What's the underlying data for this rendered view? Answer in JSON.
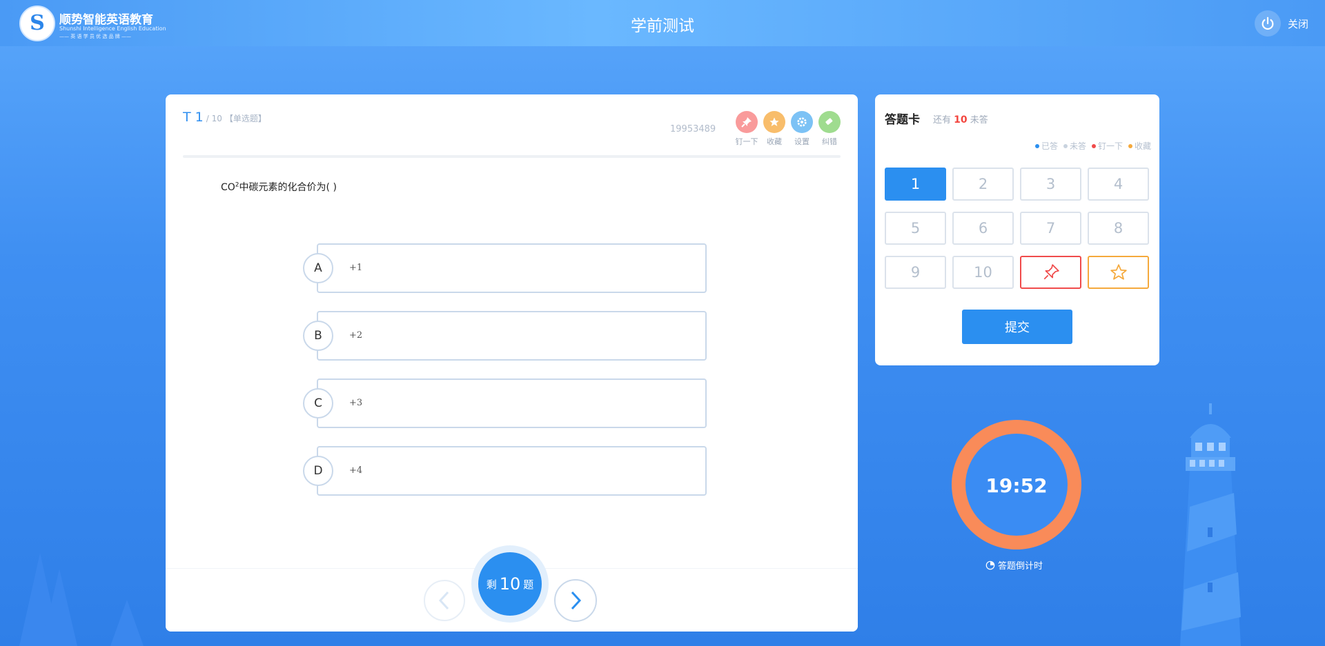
{
  "header": {
    "logo_title": "顺势智能英语教育",
    "logo_subtitle": "Shunshi Intelligence English Education",
    "logo_slogan": "—— 英 语 学 员 优 选 品 牌 ——",
    "page_title": "学前测试",
    "close_label": "关闭"
  },
  "question": {
    "number": "T 1",
    "total": "/ 10",
    "type": "【单选题】",
    "id": "19953489",
    "tools": [
      {
        "label": "钉一下",
        "icon": "pin-icon",
        "color": "#f99b9b"
      },
      {
        "label": "收藏",
        "icon": "star-icon",
        "color": "#f8bd6b"
      },
      {
        "label": "设置",
        "icon": "gear-icon",
        "color": "#7cc2f5"
      },
      {
        "label": "纠错",
        "icon": "eraser-icon",
        "color": "#9fdc8f"
      }
    ],
    "text_prefix": "CO",
    "text_sup": "2",
    "text_suffix": "中碳元素的化合价为( )",
    "options": [
      {
        "letter": "A",
        "text": "+1"
      },
      {
        "letter": "B",
        "text": "+2"
      },
      {
        "letter": "C",
        "text": "+3"
      },
      {
        "letter": "D",
        "text": "+4"
      }
    ]
  },
  "navigation": {
    "remaining_prefix": "剩",
    "remaining_count": "10",
    "remaining_suffix": "题"
  },
  "answer_card": {
    "title": "答题卡",
    "remaining_prefix": "还有",
    "remaining_count": "10",
    "remaining_suffix": "未答",
    "legend": [
      {
        "label": "已答",
        "color": "#2b8ff0"
      },
      {
        "label": "未答",
        "color": "#c9d3df"
      },
      {
        "label": "钉一下",
        "color": "#f04b4b"
      },
      {
        "label": "收藏",
        "color": "#f5a93c"
      }
    ],
    "numbers": [
      "1",
      "2",
      "3",
      "4",
      "5",
      "6",
      "7",
      "8",
      "9",
      "10"
    ],
    "active_number": "1",
    "submit_label": "提交"
  },
  "timer": {
    "value": "19:52",
    "label": "答题倒计时"
  }
}
